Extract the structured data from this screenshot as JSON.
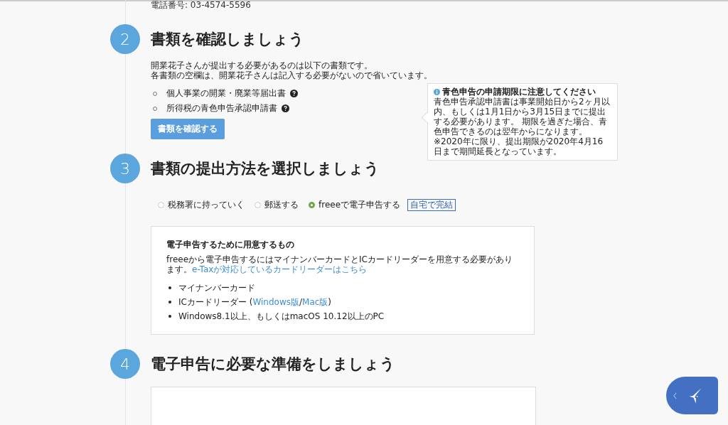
{
  "contact": {
    "phone": "電話番号: 03-4574-5596"
  },
  "steps": [
    {
      "number": "2",
      "title": "書類を確認しましょう",
      "kind": "documents",
      "description": [
        "開業花子さんが提出する必要があるのは以下の書類です。",
        "各書類の空欄は、開業花子さんは記入する必要がないので省いています。"
      ],
      "documents": [
        "個人事業の開業・廃業等届出書",
        "所得税の青色申告承認申請書"
      ],
      "button": "書類を確認する",
      "note": {
        "title": "青色申告の申請期限に注意してください",
        "body": "青色申告承認申請書は事業開始日から2ヶ月以内、もしくは1月1日から3月15日までに提出する必要があります。 期限を過ぎた場合、青色申告できるのは翌年からになります。",
        "footnote": "※2020年に限り、提出期限が2020年4月16日まで期間延長となっています。"
      }
    },
    {
      "number": "3",
      "title": "書類の提出方法を選択しましょう",
      "kind": "method",
      "options": [
        {
          "label": "税務署に持っていく",
          "selected": false
        },
        {
          "label": "郵送する",
          "selected": false
        },
        {
          "label": "freeeで電子申告する",
          "selected": true,
          "badge": "自宅で完結"
        }
      ],
      "panel": {
        "title": "電子申告するために用意するもの",
        "intro": "freeeから電子申告するにはマイナンバーカードとICカードリーダーを用意する必要があります。",
        "intro_link": "e-Taxが対応しているカードリーダーはこちら",
        "items": [
          [
            {
              "text": "マイナンバーカード",
              "link": false
            }
          ],
          [
            {
              "text": "ICカードリーダー (",
              "link": false
            },
            {
              "text": "Windows版",
              "link": true
            },
            {
              "text": "/",
              "link": false
            },
            {
              "text": "Mac版",
              "link": true
            },
            {
              "text": ")",
              "link": false
            }
          ],
          [
            {
              "text": "Windows8.1以上、もしくはmacOS 10.12以上のPC",
              "link": false
            }
          ]
        ]
      }
    },
    {
      "number": "4",
      "title": "電子申告に必要な準備をしましょう",
      "kind": "prep"
    }
  ]
}
